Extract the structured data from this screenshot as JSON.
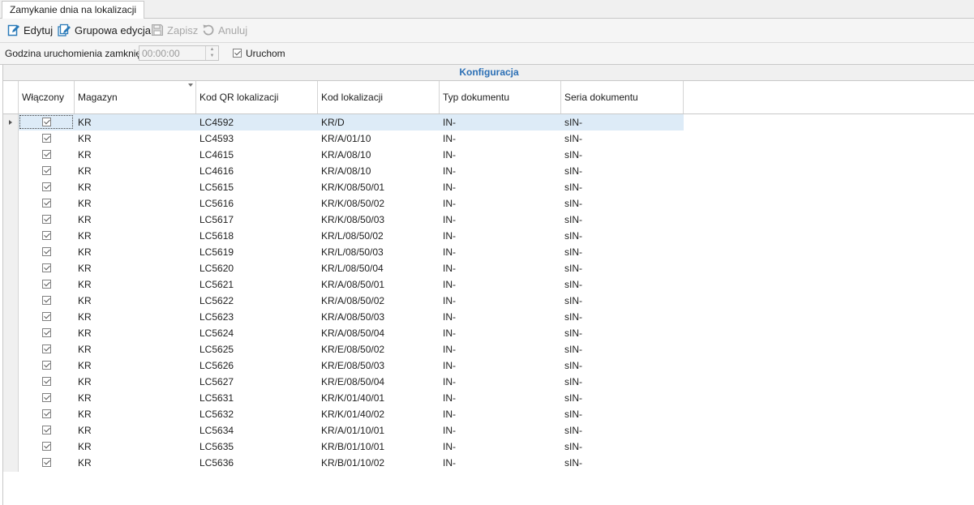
{
  "tab": {
    "title": "Zamykanie dnia na lokalizacji"
  },
  "toolbar": {
    "edit_label": "Edytuj",
    "group_edit_label": "Grupowa edycja",
    "save_label": "Zapisz",
    "cancel_label": "Anuluj"
  },
  "options": {
    "time_label": "Godzina uruchomienia zamknięcia",
    "time_value": "00:00:00",
    "run_label": "Uruchom",
    "run_checked": true
  },
  "grid": {
    "caption": "Konfiguracja",
    "columns": [
      "Włączony",
      "Magazyn",
      "Kod QR lokalizacji",
      "Kod lokalizacji",
      "Typ dokumentu",
      "Seria dokumentu"
    ],
    "rows": [
      [
        "true",
        "KR",
        "LC4592",
        "KR/D",
        "IN-",
        "sIN-"
      ],
      [
        "true",
        "KR",
        "LC4593",
        "KR/A/01/10",
        "IN-",
        "sIN-"
      ],
      [
        "true",
        "KR",
        "LC4615",
        "KR/A/08/10",
        "IN-",
        "sIN-"
      ],
      [
        "true",
        "KR",
        "LC4616",
        "KR/A/08/10",
        "IN-",
        "sIN-"
      ],
      [
        "true",
        "KR",
        "LC5615",
        "KR/K/08/50/01",
        "IN-",
        "sIN-"
      ],
      [
        "true",
        "KR",
        "LC5616",
        "KR/K/08/50/02",
        "IN-",
        "sIN-"
      ],
      [
        "true",
        "KR",
        "LC5617",
        "KR/K/08/50/03",
        "IN-",
        "sIN-"
      ],
      [
        "true",
        "KR",
        "LC5618",
        "KR/L/08/50/02",
        "IN-",
        "sIN-"
      ],
      [
        "true",
        "KR",
        "LC5619",
        "KR/L/08/50/03",
        "IN-",
        "sIN-"
      ],
      [
        "true",
        "KR",
        "LC5620",
        "KR/L/08/50/04",
        "IN-",
        "sIN-"
      ],
      [
        "true",
        "KR",
        "LC5621",
        "KR/A/08/50/01",
        "IN-",
        "sIN-"
      ],
      [
        "true",
        "KR",
        "LC5622",
        "KR/A/08/50/02",
        "IN-",
        "sIN-"
      ],
      [
        "true",
        "KR",
        "LC5623",
        "KR/A/08/50/03",
        "IN-",
        "sIN-"
      ],
      [
        "true",
        "KR",
        "LC5624",
        "KR/A/08/50/04",
        "IN-",
        "sIN-"
      ],
      [
        "true",
        "KR",
        "LC5625",
        "KR/E/08/50/02",
        "IN-",
        "sIN-"
      ],
      [
        "true",
        "KR",
        "LC5626",
        "KR/E/08/50/03",
        "IN-",
        "sIN-"
      ],
      [
        "true",
        "KR",
        "LC5627",
        "KR/E/08/50/04",
        "IN-",
        "sIN-"
      ],
      [
        "true",
        "KR",
        "LC5631",
        "KR/K/01/40/01",
        "IN-",
        "sIN-"
      ],
      [
        "true",
        "KR",
        "LC5632",
        "KR/K/01/40/02",
        "IN-",
        "sIN-"
      ],
      [
        "true",
        "KR",
        "LC5634",
        "KR/A/01/10/01",
        "IN-",
        "sIN-"
      ],
      [
        "true",
        "KR",
        "LC5635",
        "KR/B/01/10/01",
        "IN-",
        "sIN-"
      ],
      [
        "true",
        "KR",
        "LC5636",
        "KR/B/01/10/02",
        "IN-",
        "sIN-"
      ]
    ],
    "selected_row": 0
  },
  "icons": {
    "edit": "edit-icon",
    "group_edit": "group-edit-icon",
    "save": "save-icon",
    "cancel": "undo-icon",
    "filter": "filter-icon",
    "row_indicator": "row-indicator-arrow"
  },
  "colors": {
    "caption_text": "#2b6fb5",
    "selected_row": "#ddebf7",
    "icon_accent": "#2a7ab8"
  }
}
